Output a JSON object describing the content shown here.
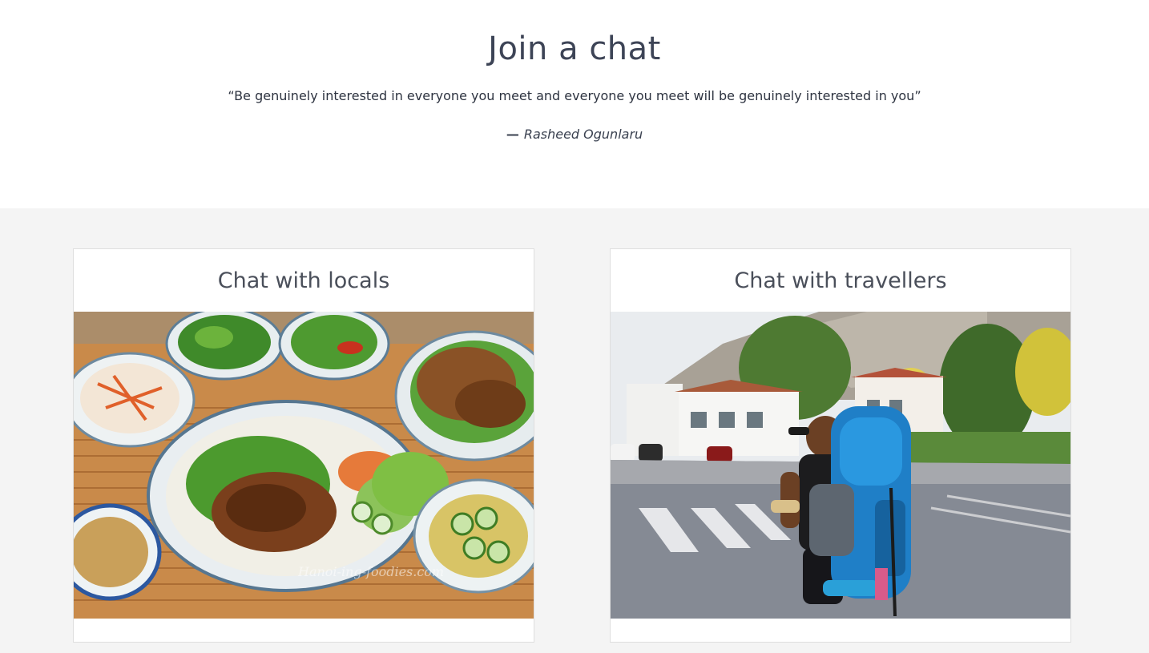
{
  "hero": {
    "title": "Join a chat",
    "quote": "“Be genuinely interested in everyone you meet and everyone you meet will be genuinely interested in you”",
    "author_dash": "—",
    "author": "Rasheed Ogunlaru"
  },
  "cards": [
    {
      "title": "Chat with locals",
      "image": "vietnamese-food-photo",
      "watermark": "Hanoi-ing-foodies.com"
    },
    {
      "title": "Chat with travellers",
      "image": "backpacker-traveller-photo"
    }
  ],
  "colors": {
    "title_text": "#3d4456",
    "section_background": "#f4f4f4",
    "card_border": "#dedede"
  }
}
